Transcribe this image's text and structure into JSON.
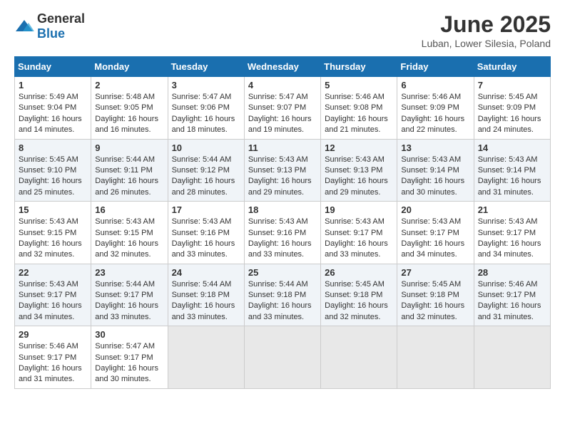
{
  "logo": {
    "general": "General",
    "blue": "Blue"
  },
  "title": "June 2025",
  "subtitle": "Luban, Lower Silesia, Poland",
  "days": [
    "Sunday",
    "Monday",
    "Tuesday",
    "Wednesday",
    "Thursday",
    "Friday",
    "Saturday"
  ],
  "weeks": [
    [
      {
        "num": "1",
        "sunrise": "5:49 AM",
        "sunset": "9:04 PM",
        "daylight": "16 hours and 14 minutes."
      },
      {
        "num": "2",
        "sunrise": "5:48 AM",
        "sunset": "9:05 PM",
        "daylight": "16 hours and 16 minutes."
      },
      {
        "num": "3",
        "sunrise": "5:47 AM",
        "sunset": "9:06 PM",
        "daylight": "16 hours and 18 minutes."
      },
      {
        "num": "4",
        "sunrise": "5:47 AM",
        "sunset": "9:07 PM",
        "daylight": "16 hours and 19 minutes."
      },
      {
        "num": "5",
        "sunrise": "5:46 AM",
        "sunset": "9:08 PM",
        "daylight": "16 hours and 21 minutes."
      },
      {
        "num": "6",
        "sunrise": "5:46 AM",
        "sunset": "9:09 PM",
        "daylight": "16 hours and 22 minutes."
      },
      {
        "num": "7",
        "sunrise": "5:45 AM",
        "sunset": "9:09 PM",
        "daylight": "16 hours and 24 minutes."
      }
    ],
    [
      {
        "num": "8",
        "sunrise": "5:45 AM",
        "sunset": "9:10 PM",
        "daylight": "16 hours and 25 minutes."
      },
      {
        "num": "9",
        "sunrise": "5:44 AM",
        "sunset": "9:11 PM",
        "daylight": "16 hours and 26 minutes."
      },
      {
        "num": "10",
        "sunrise": "5:44 AM",
        "sunset": "9:12 PM",
        "daylight": "16 hours and 28 minutes."
      },
      {
        "num": "11",
        "sunrise": "5:43 AM",
        "sunset": "9:13 PM",
        "daylight": "16 hours and 29 minutes."
      },
      {
        "num": "12",
        "sunrise": "5:43 AM",
        "sunset": "9:13 PM",
        "daylight": "16 hours and 29 minutes."
      },
      {
        "num": "13",
        "sunrise": "5:43 AM",
        "sunset": "9:14 PM",
        "daylight": "16 hours and 30 minutes."
      },
      {
        "num": "14",
        "sunrise": "5:43 AM",
        "sunset": "9:14 PM",
        "daylight": "16 hours and 31 minutes."
      }
    ],
    [
      {
        "num": "15",
        "sunrise": "5:43 AM",
        "sunset": "9:15 PM",
        "daylight": "16 hours and 32 minutes."
      },
      {
        "num": "16",
        "sunrise": "5:43 AM",
        "sunset": "9:15 PM",
        "daylight": "16 hours and 32 minutes."
      },
      {
        "num": "17",
        "sunrise": "5:43 AM",
        "sunset": "9:16 PM",
        "daylight": "16 hours and 33 minutes."
      },
      {
        "num": "18",
        "sunrise": "5:43 AM",
        "sunset": "9:16 PM",
        "daylight": "16 hours and 33 minutes."
      },
      {
        "num": "19",
        "sunrise": "5:43 AM",
        "sunset": "9:17 PM",
        "daylight": "16 hours and 33 minutes."
      },
      {
        "num": "20",
        "sunrise": "5:43 AM",
        "sunset": "9:17 PM",
        "daylight": "16 hours and 34 minutes."
      },
      {
        "num": "21",
        "sunrise": "5:43 AM",
        "sunset": "9:17 PM",
        "daylight": "16 hours and 34 minutes."
      }
    ],
    [
      {
        "num": "22",
        "sunrise": "5:43 AM",
        "sunset": "9:17 PM",
        "daylight": "16 hours and 34 minutes."
      },
      {
        "num": "23",
        "sunrise": "5:44 AM",
        "sunset": "9:17 PM",
        "daylight": "16 hours and 33 minutes."
      },
      {
        "num": "24",
        "sunrise": "5:44 AM",
        "sunset": "9:18 PM",
        "daylight": "16 hours and 33 minutes."
      },
      {
        "num": "25",
        "sunrise": "5:44 AM",
        "sunset": "9:18 PM",
        "daylight": "16 hours and 33 minutes."
      },
      {
        "num": "26",
        "sunrise": "5:45 AM",
        "sunset": "9:18 PM",
        "daylight": "16 hours and 32 minutes."
      },
      {
        "num": "27",
        "sunrise": "5:45 AM",
        "sunset": "9:18 PM",
        "daylight": "16 hours and 32 minutes."
      },
      {
        "num": "28",
        "sunrise": "5:46 AM",
        "sunset": "9:17 PM",
        "daylight": "16 hours and 31 minutes."
      }
    ],
    [
      {
        "num": "29",
        "sunrise": "5:46 AM",
        "sunset": "9:17 PM",
        "daylight": "16 hours and 31 minutes."
      },
      {
        "num": "30",
        "sunrise": "5:47 AM",
        "sunset": "9:17 PM",
        "daylight": "16 hours and 30 minutes."
      },
      null,
      null,
      null,
      null,
      null
    ]
  ],
  "labels": {
    "sunrise": "Sunrise:",
    "sunset": "Sunset:",
    "daylight": "Daylight:"
  }
}
